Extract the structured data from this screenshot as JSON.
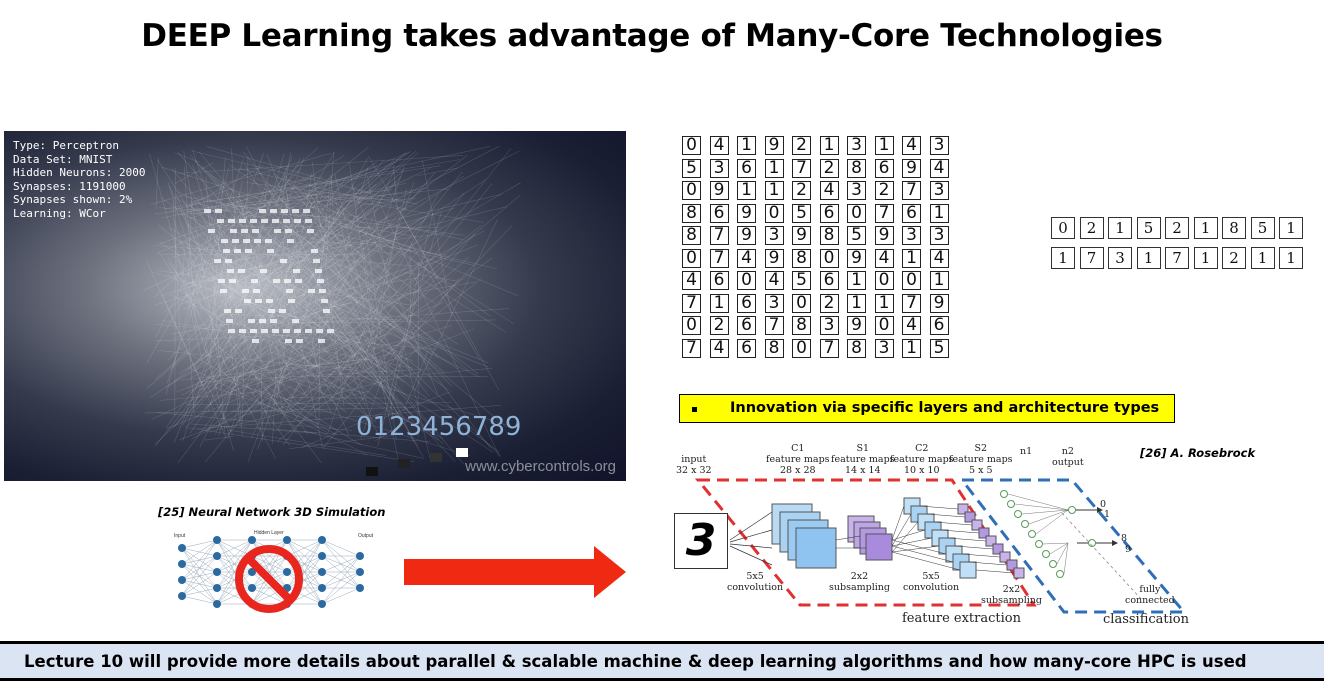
{
  "title": "DEEP Learning takes advantage of Many-Core Technologies",
  "simulation": {
    "info_lines": [
      "Type: Perceptron",
      "Data Set: MNIST",
      "Hidden Neurons: 2000",
      "Synapses: 1191000",
      "Synapses shown: 2%",
      "Learning: WCor"
    ],
    "output_digits": "0123456789",
    "watermark": "www.cybercontrols.org",
    "caption": "[25] Neural Network 3D Simulation"
  },
  "small_network": {
    "labels": [
      "Input",
      "Hidden Layer",
      "Output"
    ],
    "icon": "prohibited-icon"
  },
  "arrow": {
    "color": "#f02a12"
  },
  "mnist_grid": {
    "rows": [
      [
        "0",
        "4",
        "1",
        "9",
        "2",
        "1",
        "3",
        "1",
        "4",
        "3"
      ],
      [
        "5",
        "3",
        "6",
        "1",
        "7",
        "2",
        "8",
        "6",
        "9",
        "4"
      ],
      [
        "0",
        "9",
        "1",
        "1",
        "2",
        "4",
        "3",
        "2",
        "7",
        "3"
      ],
      [
        "8",
        "6",
        "9",
        "0",
        "5",
        "6",
        "0",
        "7",
        "6",
        "1"
      ],
      [
        "8",
        "7",
        "9",
        "3",
        "9",
        "8",
        "5",
        "9",
        "3",
        "3"
      ],
      [
        "0",
        "7",
        "4",
        "9",
        "8",
        "0",
        "9",
        "4",
        "1",
        "4"
      ],
      [
        "4",
        "6",
        "0",
        "4",
        "5",
        "6",
        "1",
        "0",
        "0",
        "1"
      ],
      [
        "7",
        "1",
        "6",
        "3",
        "0",
        "2",
        "1",
        "1",
        "7",
        "9"
      ],
      [
        "0",
        "2",
        "6",
        "7",
        "8",
        "3",
        "9",
        "0",
        "4",
        "6"
      ],
      [
        "7",
        "4",
        "6",
        "8",
        "0",
        "7",
        "8",
        "3",
        "1",
        "5"
      ]
    ]
  },
  "side_digits": {
    "rows": [
      [
        "0",
        "2",
        "1",
        "5",
        "2",
        "1",
        "8",
        "5",
        "1"
      ],
      [
        "1",
        "7",
        "3",
        "1",
        "7",
        "1",
        "2",
        "1",
        "1"
      ]
    ]
  },
  "innovation_box": {
    "text": "Innovation via specific layers and architecture types",
    "color": "#ffff00"
  },
  "citation_rosebrock": "[26] A. Rosebrock",
  "lenet": {
    "input_label": "input",
    "input_size": "32 x 32",
    "input_digit": "3",
    "c1": {
      "name": "C1",
      "label": "feature maps",
      "size": "28 x 28"
    },
    "s1": {
      "name": "S1",
      "label": "feature maps",
      "size": "14 x 14"
    },
    "c2": {
      "name": "C2",
      "label": "feature maps",
      "size": "10 x 10"
    },
    "s2": {
      "name": "S2",
      "label": "feature maps",
      "size": "5 x 5"
    },
    "n1": "n1",
    "n2": "n2",
    "output_label": "output",
    "ops": {
      "conv1": "5x5\nconvolution",
      "sub1": "2x2\nsubsampling",
      "conv2": "5x5\nconvolution",
      "sub2": "2x2\nsubsampling",
      "fc": "fully\nconnected"
    },
    "out_labels": [
      "0",
      "1",
      "8",
      "9"
    ],
    "feature_extraction": "feature extraction",
    "classification": "classification"
  },
  "bottom_bar": {
    "text": "Lecture 10 will provide more details about parallel & scalable machine & deep learning algorithms and how many-core HPC is used",
    "background": "#dbe4f3"
  }
}
